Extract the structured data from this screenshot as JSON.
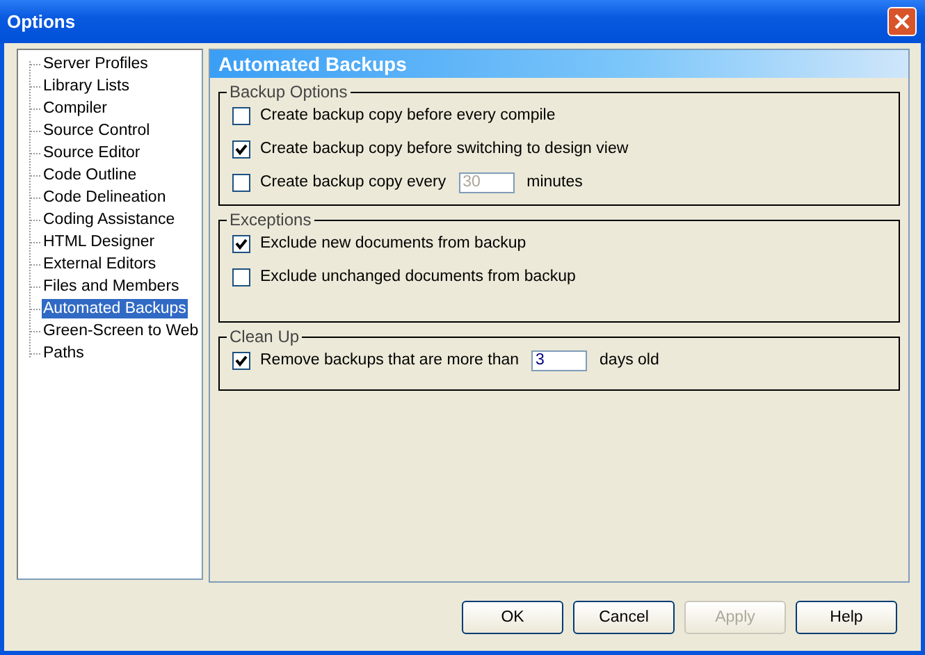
{
  "window": {
    "title": "Options"
  },
  "sidebar": {
    "items": [
      {
        "label": "Server Profiles",
        "selected": false
      },
      {
        "label": "Library Lists",
        "selected": false
      },
      {
        "label": "Compiler",
        "selected": false
      },
      {
        "label": "Source Control",
        "selected": false
      },
      {
        "label": "Source Editor",
        "selected": false
      },
      {
        "label": "Code Outline",
        "selected": false
      },
      {
        "label": "Code Delineation",
        "selected": false
      },
      {
        "label": "Coding Assistance",
        "selected": false
      },
      {
        "label": "HTML Designer",
        "selected": false
      },
      {
        "label": "External Editors",
        "selected": false
      },
      {
        "label": "Files and Members",
        "selected": false
      },
      {
        "label": "Automated Backups",
        "selected": true
      },
      {
        "label": "Green-Screen to Web",
        "selected": false
      },
      {
        "label": "Paths",
        "selected": false
      }
    ]
  },
  "panel": {
    "title": "Automated Backups",
    "groups": [
      {
        "title": "Backup Options",
        "rows": [
          {
            "kind": "checkbox",
            "label": "Create backup copy before every compile",
            "checked": false
          },
          {
            "kind": "checkbox",
            "label": "Create backup copy before switching to design view",
            "checked": true
          },
          {
            "kind": "checkbox-input",
            "label": "Create backup copy every",
            "checked": false,
            "value": "30",
            "disabled": true,
            "suffix": "minutes"
          }
        ]
      },
      {
        "title": "Exceptions",
        "rows": [
          {
            "kind": "checkbox",
            "label": "Exclude new documents from backup",
            "checked": true
          },
          {
            "kind": "checkbox",
            "label": "Exclude unchanged documents from backup",
            "checked": false
          }
        ]
      },
      {
        "title": "Clean Up",
        "rows": [
          {
            "kind": "checkbox-input",
            "label": "Remove backups that are more than",
            "checked": true,
            "value": "3",
            "disabled": false,
            "suffix": "days old"
          }
        ]
      }
    ]
  },
  "buttons": [
    {
      "label": "OK",
      "disabled": false
    },
    {
      "label": "Cancel",
      "disabled": false
    },
    {
      "label": "Apply",
      "disabled": true
    },
    {
      "label": "Help",
      "disabled": false
    }
  ]
}
